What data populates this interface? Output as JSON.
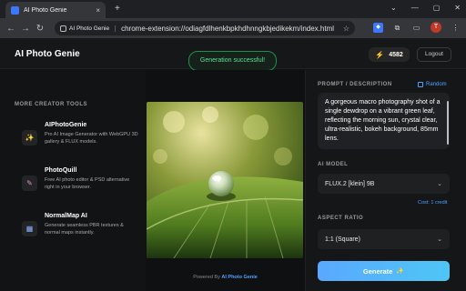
{
  "browser": {
    "tab_title": "AI Photo Genie",
    "tab_close": "×",
    "new_tab": "+",
    "window_controls": [
      "⌄",
      "—",
      "▢",
      "✕"
    ],
    "nav": {
      "back": "←",
      "forward": "→",
      "reload": "↻"
    },
    "site_chip": "AI Photo Genie",
    "url": "chrome-extension://odiagfdlhenkbpkhdhnngkbjedikekm/index.html",
    "star": "☆",
    "profile_initial": "T",
    "menu": "⋮"
  },
  "header": {
    "brand": "AI Photo Genie",
    "toast": "Generation successful!",
    "credits_icon": "⚡",
    "credits": "4582",
    "logout": "Logout"
  },
  "left": {
    "heading": "MORE CREATOR TOOLS",
    "tools": [
      {
        "name": "AIPhotoGenie",
        "desc": "Pro AI Image Generator with WebGPU 3D gallery & FLUX models.",
        "icon": "✨"
      },
      {
        "name": "PhotoQuill",
        "desc": "Free AI photo editor & PSD alternative right in your browser.",
        "icon": "✎"
      },
      {
        "name": "NormalMap AI",
        "desc": "Generate seamless PBR textures & normal maps instantly.",
        "icon": "▦"
      }
    ]
  },
  "center": {
    "image_icon": "dewdrop-leaf-image",
    "powered_prefix": "Powered By",
    "powered_link": "AI Photo Genie"
  },
  "right": {
    "prompt_label": "PROMPT / DESCRIPTION",
    "random_label": "Random",
    "prompt_text": "A gorgeous macro photography shot of a single dewdrop on a vibrant green leaf, reflecting the morning sun, crystal clear, ultra-realistic, bokeh background, 85mm lens.",
    "model_label": "AI MODEL",
    "model_value": "FLUX.2 [klein] 9B",
    "cost": "Cost: 1 credit",
    "aspect_label": "ASPECT RATIO",
    "aspect_value": "1:1 (Square)",
    "chevron": "⌄",
    "generate_label": "Generate",
    "generate_icon": "✨"
  },
  "colors": {
    "accent": "#4da3ff",
    "success": "#5fe08f",
    "bolt": "#f5b400"
  }
}
